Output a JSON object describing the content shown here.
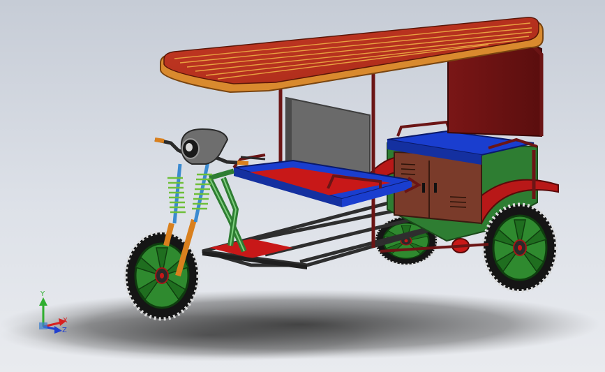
{
  "viewport": {
    "background_top": "#c6ccd6",
    "background_bottom": "#e9ebef"
  },
  "model": {
    "colors": {
      "roof_slats": "#b8301f",
      "roof_rim": "#d98a2e",
      "frame": "#6b1515",
      "back_panel": "#6b1212",
      "seat_blue": "#1a3ecf",
      "seat_red": "#c81818",
      "body_green": "#2e7d32",
      "cabinet": "#7a3b2a",
      "fork_orange": "#d9801e",
      "spring_green": "#6fbf3a",
      "chassis": "#3a3a3a",
      "tire": "#1a1a1a",
      "rim_green": "#2f8a2f",
      "headlight": "#6e6e6e"
    },
    "icons": [
      "headlight-icon",
      "wheel-icon"
    ]
  },
  "triad": {
    "y_label": "Y",
    "x_label": "X",
    "z_label": "Z",
    "y_color": "#2fae2f",
    "x_color": "#d82020",
    "z_color": "#2040d0"
  }
}
